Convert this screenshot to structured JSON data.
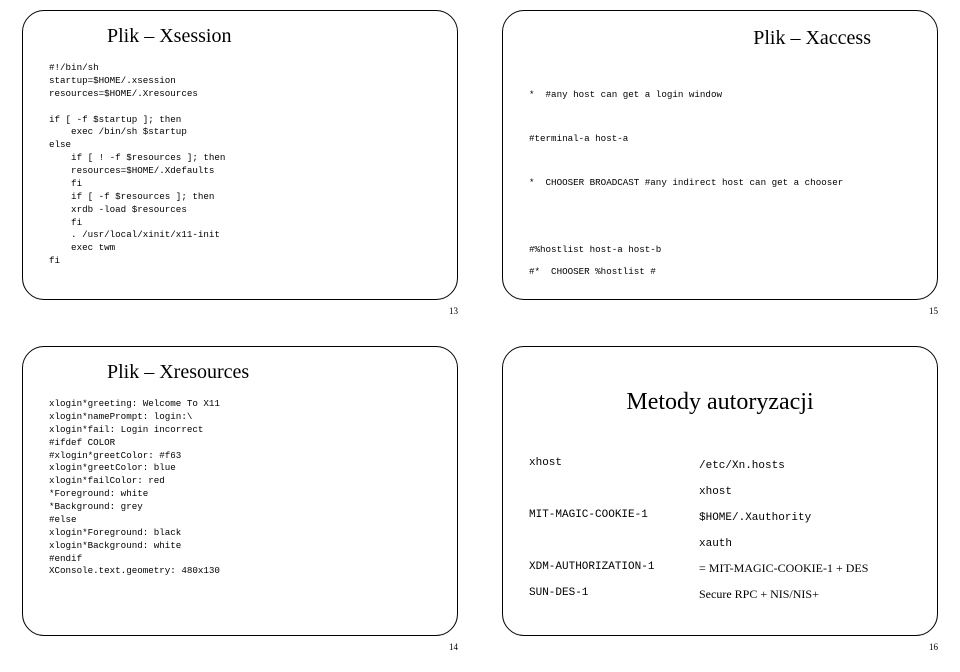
{
  "slides": {
    "s13": {
      "title": "Plik – Xsession",
      "code": "#!/bin/sh\nstartup=$HOME/.xsession\nresources=$HOME/.Xresources\n\nif [ -f $startup ]; then\n    exec /bin/sh $startup\nelse\n    if [ ! -f $resources ]; then\n    resources=$HOME/.Xdefaults\n    fi\n    if [ -f $resources ]; then\n    xrdb -load $resources\n    fi\n    . /usr/local/xinit/x11-init\n    exec twm\nfi",
      "page": "13"
    },
    "s15": {
      "title": "Plik – Xaccess",
      "code": "*  #any host can get a login window\n\n#terminal-a host-a\n\n*  CHOOSER BROADCAST #any indirect host can get a chooser\n\n\n#%hostlist host-a host-b\n#*  CHOOSER %hostlist #",
      "page": "15"
    },
    "s14": {
      "title": "Plik – Xresources",
      "code": "xlogin*greeting: Welcome To X11\nxlogin*namePrompt: login:\\\nxlogin*fail: Login incorrect\n#ifdef COLOR\n#xlogin*greetColor: #f63\nxlogin*greetColor: blue\nxlogin*failColor: red\n*Foreground: white\n*Background: grey\n#else\nxlogin*Foreground: black\nxlogin*Background: white\n#endif\nXConsole.text.geometry: 480x130",
      "page": "14"
    },
    "s16": {
      "title": "Metody autoryzacji",
      "rows": [
        {
          "left": "xhost",
          "right_tt": "/etc/Xn.hosts",
          "right": ""
        },
        {
          "left": "",
          "right_tt": "xhost",
          "right": ""
        },
        {
          "left": "MIT-MAGIC-COOKIE-1",
          "right_tt": "$HOME/.Xauthority",
          "right": ""
        },
        {
          "left": "",
          "right_tt": "xauth",
          "right": ""
        },
        {
          "left": "XDM-AUTHORIZATION-1",
          "right_tt": "",
          "right": "= MIT-MAGIC-COOKIE-1 + DES"
        },
        {
          "left": "SUN-DES-1",
          "right_tt": "",
          "right": "Secure RPC + NIS/NIS+"
        }
      ],
      "page": "16"
    }
  }
}
